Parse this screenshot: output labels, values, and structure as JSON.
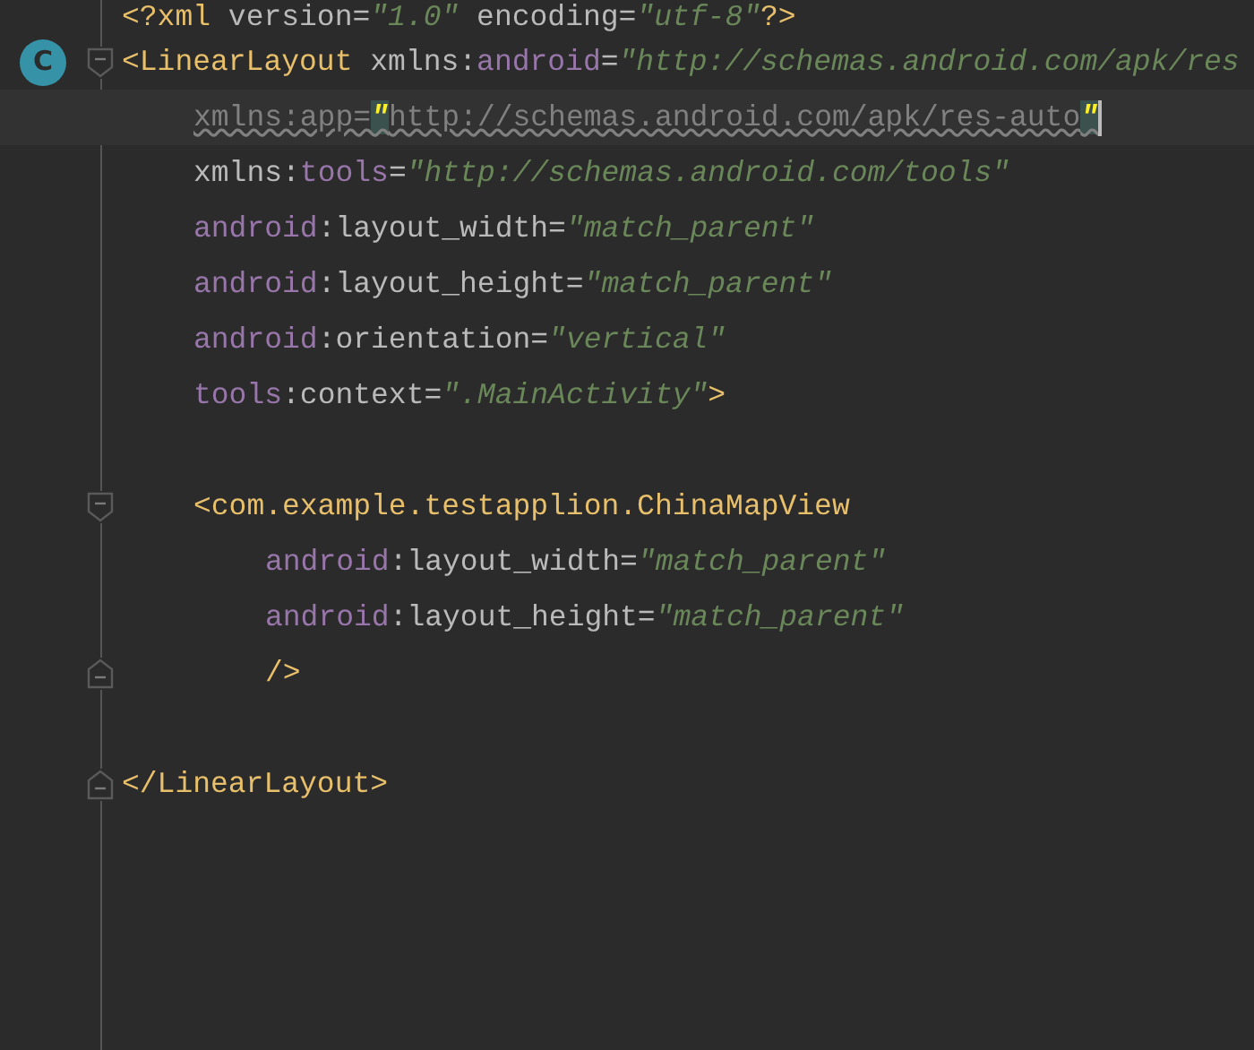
{
  "editor": {
    "lines": [
      {
        "current": false,
        "kind": "plain",
        "tokens": [
          {
            "t": "<?xml ",
            "kind": "tag"
          },
          {
            "t": "version=",
            "kind": "attr"
          },
          {
            "t": "\"1.0\"",
            "kind": "string"
          },
          {
            "t": " encoding=",
            "kind": "attr"
          },
          {
            "t": "\"utf-8\"",
            "kind": "string"
          },
          {
            "t": "?>",
            "kind": "tag"
          }
        ]
      },
      {
        "current": false,
        "kind": "fold-start",
        "badge": "C",
        "tokens": [
          {
            "t": "<LinearLayout",
            "kind": "tag"
          },
          {
            "t": " xmlns:",
            "kind": "attr"
          },
          {
            "t": "android",
            "kind": "ns"
          },
          {
            "t": "=",
            "kind": "attr"
          },
          {
            "t": "\"http://schemas.android.com/apk/res",
            "kind": "string"
          }
        ],
        "children": [
          {
            "current": true,
            "kind": "plain",
            "tokens": [
              {
                "t": "xmlns:app=",
                "kind": "unused"
              },
              {
                "t": "\"",
                "kind": "match"
              },
              {
                "t": "http://schemas.android.com/apk/res-auto",
                "kind": "unused"
              },
              {
                "t": "\"",
                "kind": "match"
              }
            ]
          },
          {
            "current": false,
            "kind": "plain",
            "tokens": [
              {
                "t": "xmlns:",
                "kind": "attr"
              },
              {
                "t": "tools",
                "kind": "ns"
              },
              {
                "t": "=",
                "kind": "attr"
              },
              {
                "t": "\"http://schemas.android.com/tools\"",
                "kind": "string"
              }
            ]
          },
          {
            "current": false,
            "kind": "plain",
            "tokens": [
              {
                "t": "android",
                "kind": "ns"
              },
              {
                "t": ":layout_width=",
                "kind": "attr"
              },
              {
                "t": "\"match_parent\"",
                "kind": "string"
              }
            ]
          },
          {
            "current": false,
            "kind": "plain",
            "tokens": [
              {
                "t": "android",
                "kind": "ns"
              },
              {
                "t": ":layout_height=",
                "kind": "attr"
              },
              {
                "t": "\"match_parent\"",
                "kind": "string"
              }
            ]
          },
          {
            "current": false,
            "kind": "plain",
            "tokens": [
              {
                "t": "android",
                "kind": "ns"
              },
              {
                "t": ":orientation=",
                "kind": "attr"
              },
              {
                "t": "\"vertical\"",
                "kind": "string"
              }
            ]
          },
          {
            "current": false,
            "kind": "plain",
            "tokens": [
              {
                "t": "tools",
                "kind": "ns"
              },
              {
                "t": ":context=",
                "kind": "attr"
              },
              {
                "t": "\".MainActivity\"",
                "kind": "string"
              },
              {
                "t": ">",
                "kind": "tag"
              }
            ]
          },
          {
            "current": false,
            "kind": "plain"
          },
          {
            "current": false,
            "kind": "fold-start",
            "tokens": [
              {
                "t": "<com.example.testapplion.ChinaMapView",
                "kind": "tag"
              }
            ],
            "children": [
              {
                "current": false,
                "kind": "plain",
                "tokens": [
                  {
                    "t": "android",
                    "kind": "ns"
                  },
                  {
                    "t": ":layout_width=",
                    "kind": "attr"
                  },
                  {
                    "t": "\"match_parent\"",
                    "kind": "string"
                  }
                ]
              },
              {
                "current": false,
                "kind": "plain",
                "tokens": [
                  {
                    "t": "android",
                    "kind": "ns"
                  },
                  {
                    "t": ":layout_height=",
                    "kind": "attr"
                  },
                  {
                    "t": "\"match_parent\"",
                    "kind": "string"
                  }
                ]
              },
              {
                "current": false,
                "kind": "fold-end",
                "tokens": [
                  {
                    "t": "/>",
                    "kind": "tag"
                  }
                ]
              }
            ]
          },
          {
            "current": false,
            "kind": "plain"
          }
        ]
      },
      {
        "current": false,
        "kind": "fold-end",
        "tokens": [
          {
            "t": "</LinearLayout>",
            "kind": "tag"
          }
        ]
      }
    ]
  }
}
